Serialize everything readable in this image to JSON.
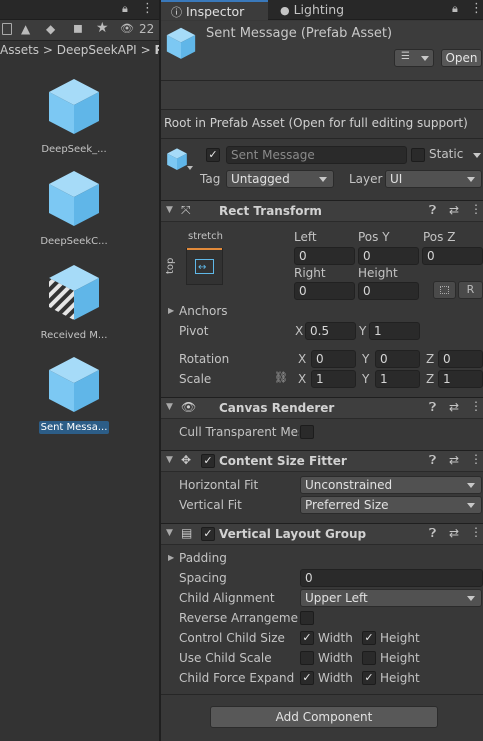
{
  "left_panel": {
    "toolbar": {
      "count": "22"
    },
    "breadcrumb": [
      "Assets",
      ">",
      "DeepSeekAPI",
      ">",
      "P"
    ],
    "assets": [
      {
        "label": "DeepSeek_..."
      },
      {
        "label": "DeepSeekC..."
      },
      {
        "label": "Received M..."
      },
      {
        "label": "Sent Messa..."
      }
    ]
  },
  "tabs": {
    "inspector": "Inspector",
    "lighting": "Lighting"
  },
  "header": {
    "title": "Sent Message (Prefab Asset)",
    "open_label": "Open"
  },
  "prefab_notice": "Root in Prefab Asset (Open for full editing support)",
  "object": {
    "name": "Sent Message",
    "static_label": "Static",
    "tag_label": "Tag",
    "tag_value": "Untagged",
    "layer_label": "Layer",
    "layer_value": "UI"
  },
  "rect_transform": {
    "title": "Rect Transform",
    "anchor_h": "stretch",
    "anchor_v": "top",
    "col1": "Left",
    "col2": "Pos Y",
    "col3": "Pos Z",
    "left": "0",
    "pos_y": "0",
    "pos_z": "0",
    "right_label": "Right",
    "height_label": "Height",
    "right": "0",
    "height": "0",
    "raw_btn": "R",
    "anchors_label": "Anchors",
    "pivot_label": "Pivot",
    "pivot_x": "0.5",
    "pivot_y": "1",
    "rotation_label": "Rotation",
    "rot_x": "0",
    "rot_y": "0",
    "rot_z": "0",
    "scale_label": "Scale",
    "scale_x": "1",
    "scale_y": "1",
    "scale_z": "1",
    "x": "X",
    "y": "Y",
    "z": "Z"
  },
  "canvas_renderer": {
    "title": "Canvas Renderer",
    "cull_label": "Cull Transparent Mes"
  },
  "content_size_fitter": {
    "title": "Content Size Fitter",
    "hfit_label": "Horizontal Fit",
    "hfit_value": "Unconstrained",
    "vfit_label": "Vertical Fit",
    "vfit_value": "Preferred Size"
  },
  "vertical_layout_group": {
    "title": "Vertical Layout Group",
    "padding_label": "Padding",
    "spacing_label": "Spacing",
    "spacing_value": "0",
    "alignment_label": "Child Alignment",
    "alignment_value": "Upper Left",
    "reverse_label": "Reverse Arrangemen",
    "ccs_label": "Control Child Size",
    "ucs_label": "Use Child Scale",
    "cfe_label": "Child Force Expand",
    "width": "Width",
    "height": "Height",
    "ccs_width": true,
    "ccs_height": true,
    "ucs_width": false,
    "ucs_height": false,
    "cfe_width": true,
    "cfe_height": true
  },
  "add_component": "Add Component",
  "colors": {
    "accent": "#3a79bb",
    "cube": "#7cc8f3",
    "selection": "#2c5d87"
  }
}
